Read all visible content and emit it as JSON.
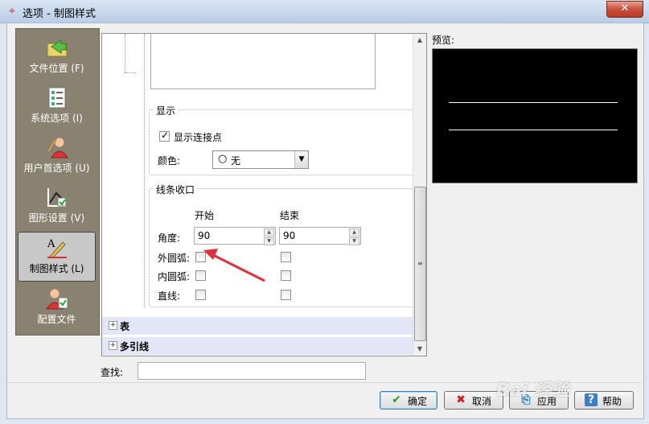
{
  "window": {
    "title": "选项 - 制图样式",
    "close_glyph": "✕"
  },
  "sidebar": {
    "items": [
      {
        "label": "文件位置 (F)",
        "icon": "folder-arrow-icon"
      },
      {
        "label": "系统选项 (I)",
        "icon": "checklist-icon"
      },
      {
        "label": "用户首选项 (U)",
        "icon": "user-preferences-icon"
      },
      {
        "label": "图形设置 (V)",
        "icon": "graphics-settings-icon"
      },
      {
        "label": "制图样式 (L)",
        "icon": "drafting-style-icon",
        "active": true
      },
      {
        "label": "配置文件",
        "icon": "profile-icon"
      }
    ]
  },
  "display_group": {
    "title": "显示",
    "show_connection_points": {
      "label": "显示连接点",
      "checked": true
    },
    "color": {
      "label": "颜色:",
      "value": "无"
    }
  },
  "line_end_group": {
    "title": "线条收口",
    "col_start": "开始",
    "col_end": "结束",
    "angle_label": "角度:",
    "angle_start": "90",
    "angle_end": "90",
    "outer_arc_label": "外圆弧:",
    "inner_arc_label": "内圆弧:",
    "line_label": "直线:"
  },
  "tree": {
    "table": "表",
    "multileader": "多引线"
  },
  "preview": {
    "label": "预览:"
  },
  "search": {
    "label": "查找:",
    "value": ""
  },
  "buttons": {
    "ok": "确定",
    "cancel": "取消",
    "apply": "应用",
    "help": "帮助"
  },
  "watermark": "Bai 经验"
}
